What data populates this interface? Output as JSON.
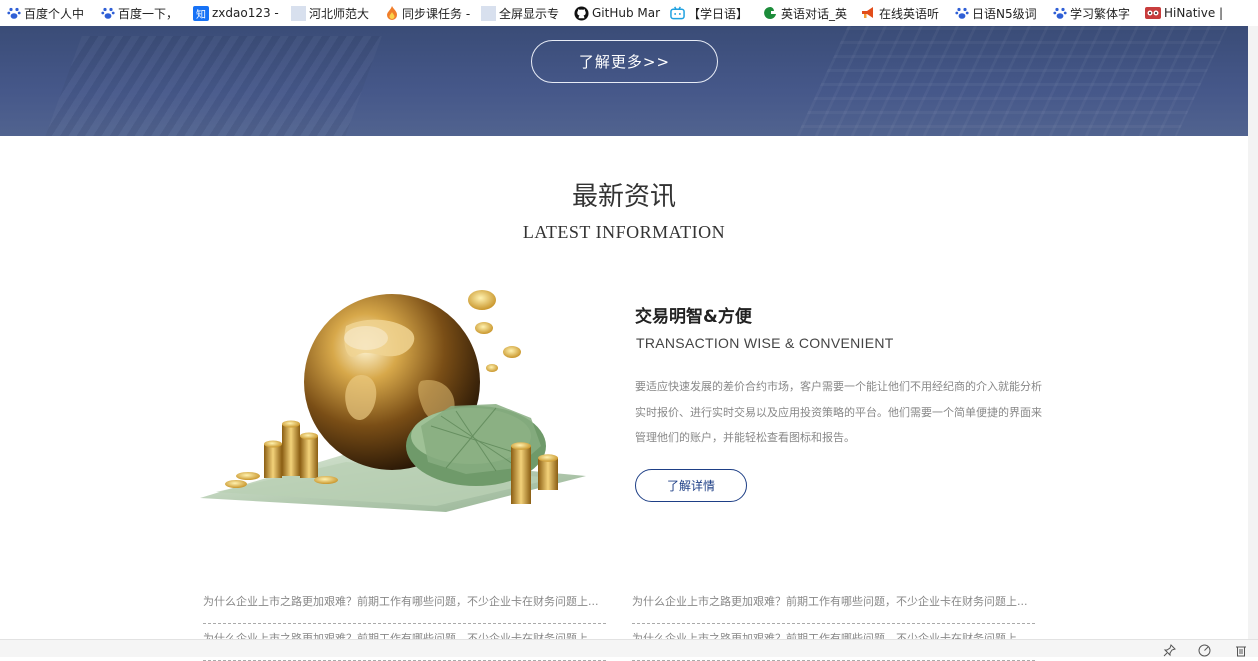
{
  "bookmarks": [
    {
      "label": "百度个人中",
      "icon": "baidu-paw-icon",
      "color": "#2f5fd6"
    },
    {
      "label": "百度一下，",
      "icon": "baidu-paw-icon",
      "color": "#2f5fd6"
    },
    {
      "label": "zxdao123 -",
      "icon": "zhihu-icon",
      "color": "#1772f6"
    },
    {
      "label": "河北师范大",
      "icon": "blank-page-icon",
      "color": "#d8e0ee"
    },
    {
      "label": "同步课任务 -",
      "icon": "flame-icon",
      "color": "#f07d2a"
    },
    {
      "label": "全屏显示专",
      "icon": "blank-page-icon",
      "color": "#d8e0ee"
    },
    {
      "label": "GitHub Mar",
      "icon": "github-icon",
      "color": "#111111"
    },
    {
      "label": "【学日语】",
      "icon": "bilibili-icon",
      "color": "#1fa1e0"
    },
    {
      "label": "英语对话_英",
      "icon": "leaf-icon",
      "color": "#1c8c3a"
    },
    {
      "label": "在线英语听",
      "icon": "megaphone-icon",
      "color": "#e24d1a"
    },
    {
      "label": "日语N5级词",
      "icon": "baidu-paw-icon",
      "color": "#2f5fd6"
    },
    {
      "label": "学习繁体字",
      "icon": "baidu-paw-icon",
      "color": "#2f5fd6"
    },
    {
      "label": "HiNative |",
      "icon": "hinative-icon",
      "color": "#c83d3d"
    }
  ],
  "hero": {
    "button_label": "了解更多>>"
  },
  "section": {
    "title_cn": "最新资讯",
    "title_en": "LATEST INFORMATION"
  },
  "article": {
    "title": "交易明智&方便",
    "subtitle": "TRANSACTION WISE & CONVENIENT",
    "body": "要适应快速发展的差价合约市场，客户需要一个能让他们不用经纪商的介入就能分析实时报价、进行实时交易以及应用投资策略的平台。他们需要一个简单便捷的界面来管理他们的账户，并能轻松查看图标和报告。",
    "button_label": "了解详情"
  },
  "news": {
    "left": [
      "为什么企业上市之路更加艰难？前期工作有哪些问题，不少企业卡在财务问题上...",
      "为什么企业上市之路更加艰难？前期工作有哪些问题，不少企业卡在财务问题上..."
    ],
    "right": [
      "为什么企业上市之路更加艰难？前期工作有哪些问题，不少企业卡在财务问题上...",
      "为什么企业上市之路更加艰难？前期工作有哪些问题，不少企业卡在财务问题上..."
    ]
  },
  "colors": {
    "hero_bg": "#46588a",
    "accent": "#1e3f86",
    "muted_text": "#888888"
  },
  "statusbar": {
    "icons": [
      "pin-icon",
      "speed-icon",
      "trash-icon"
    ]
  }
}
